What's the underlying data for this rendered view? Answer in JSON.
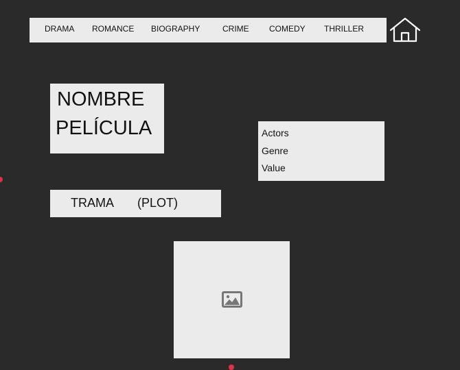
{
  "nav": {
    "items": [
      {
        "label": "DRAMA"
      },
      {
        "label": "ROMANCE"
      },
      {
        "label": "BIOGRAPHY"
      },
      {
        "label": "CRIME"
      },
      {
        "label": "COMEDY"
      },
      {
        "label": "THRILLER"
      }
    ],
    "home_icon": "home-icon"
  },
  "movie": {
    "title_line1": "NOMBRE",
    "title_line2": "PELÍCULA",
    "info": [
      "Actors",
      "Genre",
      "Value"
    ],
    "plot_label": "TRAMA",
    "plot_sublabel": "(PLOT)",
    "poster_icon": "image-placeholder-icon"
  },
  "colors": {
    "background": "#2a2a2a",
    "panel": "#ebebeb",
    "accent_dot": "#e0304a"
  }
}
